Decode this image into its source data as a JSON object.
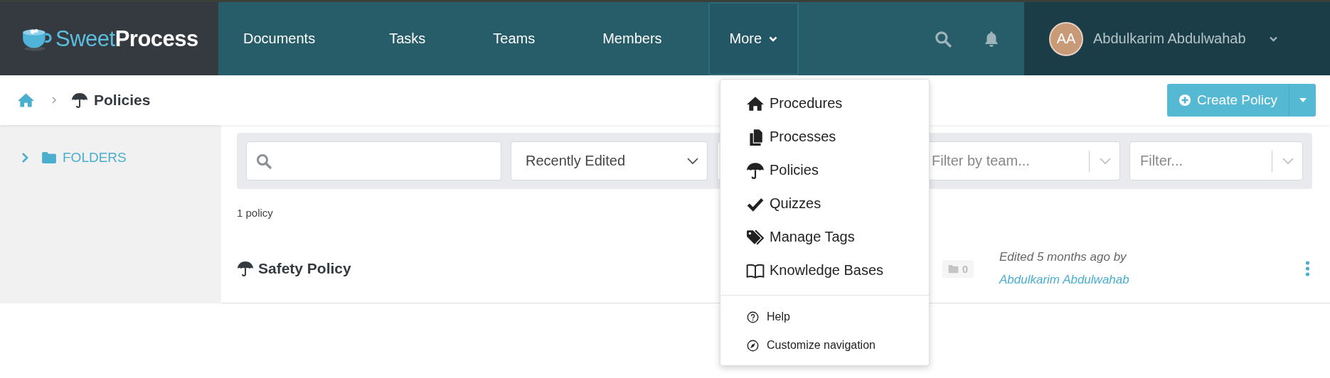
{
  "brand": {
    "light": "Sweet",
    "bold": "Process"
  },
  "nav": [
    {
      "label": "Documents",
      "selected": false,
      "kind": "link"
    },
    {
      "label": "Tasks",
      "selected": false,
      "kind": "link"
    },
    {
      "label": "Teams",
      "selected": false,
      "kind": "link"
    },
    {
      "label": "Members",
      "selected": false,
      "kind": "link"
    },
    {
      "label": "More",
      "selected": true,
      "kind": "dropdown"
    }
  ],
  "user": {
    "initials": "AA",
    "name": "Abdulkarim Abdulwahab"
  },
  "breadcrumb": {
    "current": "Policies"
  },
  "create_button": {
    "label": "Create Policy"
  },
  "sidebar": {
    "items": [
      {
        "label": "FOLDERS",
        "expanded": false
      }
    ]
  },
  "filters": {
    "sort": {
      "value": "Recently Edited"
    },
    "team": {
      "placeholder": "Filter by team..."
    },
    "other": {
      "placeholder": "Filter..."
    }
  },
  "count": "1 policy",
  "rows": [
    {
      "title": "Safety Policy",
      "folders": "0",
      "edited": "Edited 5 months ago by",
      "editor": "Abdulkarim Abdulwahab"
    }
  ],
  "menu": {
    "items": [
      {
        "label": "Procedures",
        "kind": "home"
      },
      {
        "label": "Processes",
        "kind": "copy"
      },
      {
        "label": "Policies",
        "kind": "umbrella"
      },
      {
        "label": "Quizzes",
        "kind": "check"
      },
      {
        "label": "Manage Tags",
        "kind": "tags"
      },
      {
        "label": "Knowledge Bases",
        "kind": "book"
      }
    ],
    "footer": [
      {
        "label": "Help",
        "kind": "help"
      },
      {
        "label": "Customize navigation",
        "kind": "compass"
      }
    ]
  }
}
